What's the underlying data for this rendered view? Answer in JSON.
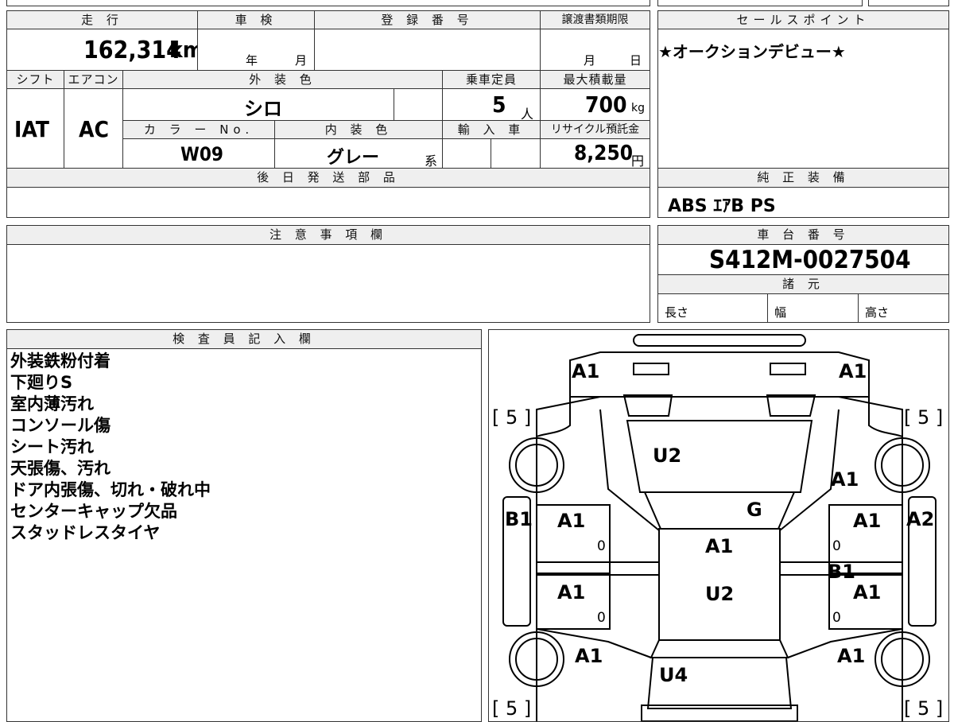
{
  "header_row": {
    "mileage_label": "走 行",
    "mileage_value": "162,314",
    "mileage_unit": "km",
    "inspection_label": "車 検",
    "inspection_year": "年",
    "inspection_month": "月",
    "registration_label": "登 録 番 号",
    "transfer_label": "譲渡書類期限",
    "transfer_month": "月",
    "transfer_day": "日"
  },
  "row2": {
    "shift_label": "シフト",
    "shift_value": "IAT",
    "ac_label": "エアコン",
    "ac_value": "AC",
    "ext_color_label": "外 装 色",
    "ext_color_value": "シロ",
    "capacity_label": "乗車定員",
    "capacity_value": "5",
    "capacity_unit": "人",
    "maxload_label": "最大積載量",
    "maxload_value": "700",
    "maxload_unit": "kg",
    "color_no_label": "カ ラ ー No.",
    "color_no_value": "W09",
    "int_color_label": "内 装 色",
    "int_color_value": "グレー",
    "int_color_suffix": "系",
    "import_label": "輸 入 車",
    "recycle_label": "リサイクル預託金",
    "recycle_value": "8,250",
    "recycle_unit": "円"
  },
  "later_parts": {
    "label": "後 日 発 送 部 品",
    "value": ""
  },
  "notes": {
    "label": "注 意 事 項 欄",
    "value": ""
  },
  "sales_point": {
    "label": "セールスポイント",
    "value": "★オークションデビュー★"
  },
  "equipment": {
    "label": "純 正 装 備",
    "value": "ABS ｴｱB PS"
  },
  "chassis": {
    "label": "車 台 番 号",
    "value": "S412M-0027504"
  },
  "specs": {
    "label": "諸 元",
    "length": "長さ",
    "width": "幅",
    "height": "高さ"
  },
  "inspector": {
    "label": "検 査 員 記 入 欄",
    "items": [
      "外装鉄粉付着",
      "下廻りS",
      "室内薄汚れ",
      "コンソール傷",
      "シート汚れ",
      "天張傷、汚れ",
      "ドア内張傷、切れ・破れ中",
      "センターキャップ欠品",
      "スタッドレスタイヤ"
    ]
  },
  "diagram": {
    "tyre_fl": "[ 5 ]",
    "tyre_fr": "[ 5 ]",
    "tyre_rl": "[ 5 ]",
    "tyre_rr": "[ 5 ]",
    "front_left": "A1",
    "front_right": "A1",
    "hood": "U2",
    "fender_right": "A1",
    "windshield": "G",
    "pillar_left": "B1",
    "pillar_right": "A2",
    "door_fl": "A1",
    "door_fr": "A1",
    "roof": "A1",
    "roof_rear": "U2",
    "door_rl": "A1",
    "door_rr": "A1",
    "center_pillar_right": "B1",
    "quarter_left": "A1",
    "quarter_right": "A1",
    "rear": "U4",
    "zero_fl": "0",
    "zero_fr": "0",
    "zero_rl": "0",
    "zero_rr": "0"
  }
}
